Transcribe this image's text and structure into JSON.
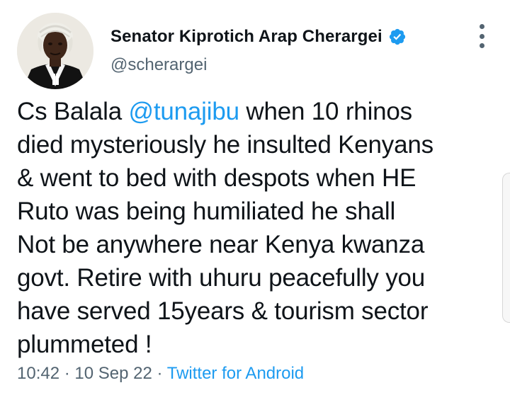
{
  "author": {
    "display_name": "Senator Kiprotich Arap Cherargei",
    "handle": "@scherargei",
    "verified_color": "#1d9bf0",
    "avatar_icon": "profile-photo"
  },
  "menu": {
    "icon": "more-vertical-icon"
  },
  "tweet": {
    "line1_before": "Cs Balala ",
    "mention": "@tunajibu",
    "line1_after": " when 10 rhinos",
    "line2": "died mysteriously he insulted Kenyans",
    "line3": "& went to bed with despots when HE",
    "line4": "Ruto was being humiliated he shall",
    "line5": "Not be anywhere near Kenya kwanza",
    "line6": "govt. Retire with uhuru peacefully you",
    "line7": "have served 15years & tourism sector",
    "line8": "plummeted !"
  },
  "meta": {
    "time": "10:42",
    "sep1": " · ",
    "date": "10 Sep 22",
    "sep2": " · ",
    "source": "Twitter for Android"
  },
  "colors": {
    "text": "#0f1419",
    "secondary": "#536471",
    "link": "#1d9bf0"
  }
}
